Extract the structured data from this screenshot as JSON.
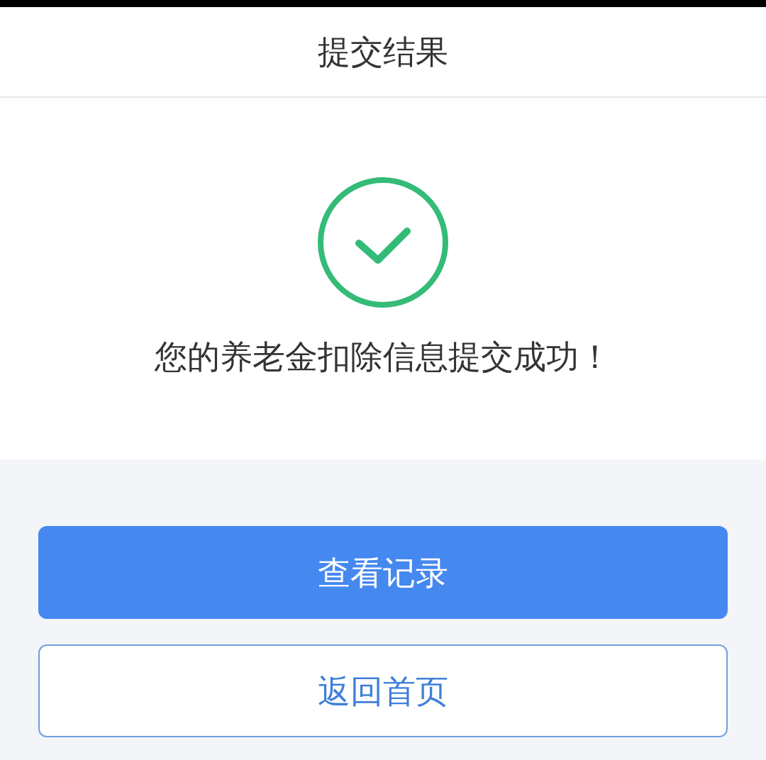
{
  "header": {
    "title": "提交结果"
  },
  "result": {
    "kind": "success",
    "message": "您的养老金扣除信息提交成功！"
  },
  "buttons": [
    {
      "label": "查看记录",
      "kind": "primary"
    },
    {
      "label": "返回首页",
      "kind": "secondary"
    }
  ]
}
